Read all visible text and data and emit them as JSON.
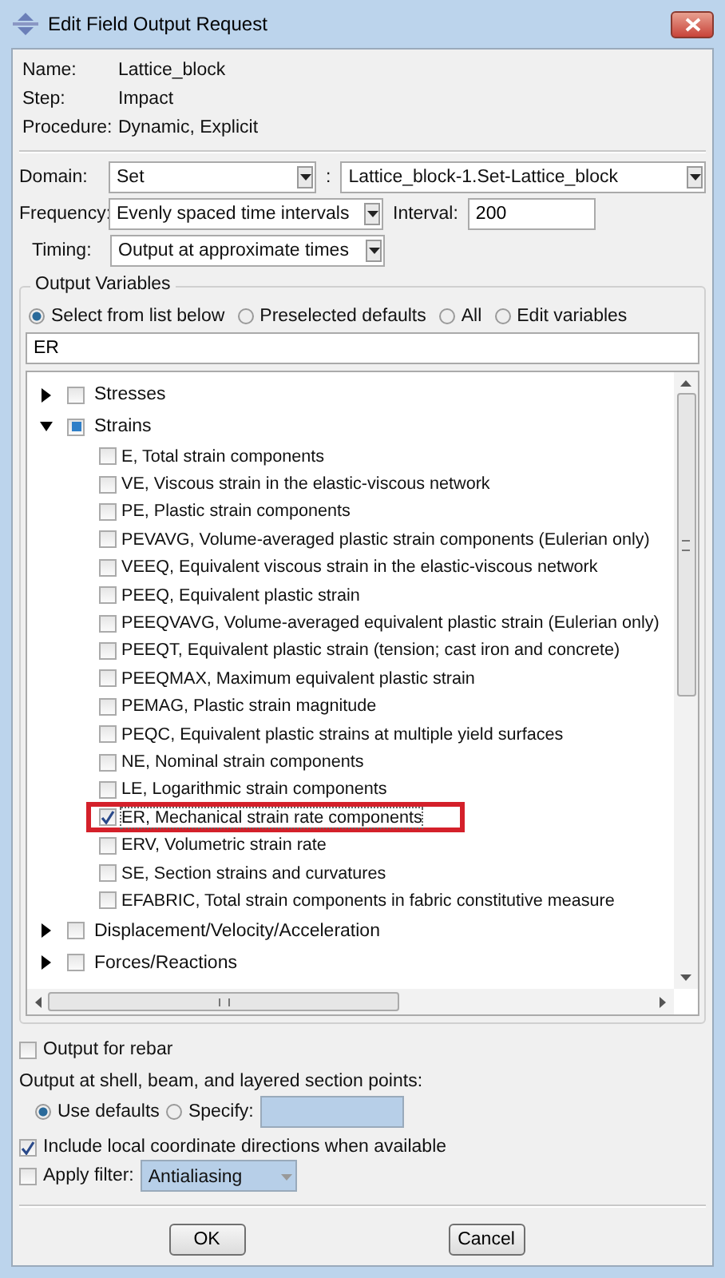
{
  "window": {
    "title": "Edit Field Output Request"
  },
  "info": [
    {
      "label": "Name:",
      "value": "Lattice_block"
    },
    {
      "label": "Step:",
      "value": "Impact"
    },
    {
      "label": "Procedure:",
      "value": "Dynamic, Explicit"
    }
  ],
  "domain": {
    "label": "Domain:",
    "value": "Set",
    "separator": ":",
    "target": "Lattice_block-1.Set-Lattice_block"
  },
  "frequency": {
    "label": "Frequency:",
    "value": "Evenly spaced time intervals",
    "interval_label": "Interval:",
    "interval": "200"
  },
  "timing": {
    "label": "Timing:",
    "value": "Output at approximate times"
  },
  "output_variables": {
    "title": "Output Variables",
    "modes": [
      {
        "label": "Select from list below",
        "selected": true
      },
      {
        "label": "Preselected defaults",
        "selected": false
      },
      {
        "label": "All",
        "selected": false
      },
      {
        "label": "Edit variables",
        "selected": false
      }
    ],
    "filter": "ER",
    "tree": [
      {
        "label": "Stresses",
        "expanded": false,
        "checked": false,
        "partial": false
      },
      {
        "label": "Strains",
        "expanded": true,
        "checked": false,
        "partial": true,
        "children": [
          {
            "label": "E, Total strain components",
            "checked": false,
            "highlighted": false
          },
          {
            "label": "VE, Viscous strain in the elastic-viscous network",
            "checked": false,
            "highlighted": false
          },
          {
            "label": "PE, Plastic strain components",
            "checked": false,
            "highlighted": false
          },
          {
            "label": "PEVAVG, Volume-averaged plastic strain components (Eulerian only)",
            "checked": false,
            "highlighted": false
          },
          {
            "label": "VEEQ, Equivalent viscous strain in the elastic-viscous network",
            "checked": false,
            "highlighted": false
          },
          {
            "label": "PEEQ, Equivalent plastic strain",
            "checked": false,
            "highlighted": false
          },
          {
            "label": "PEEQVAVG, Volume-averaged equivalent plastic strain (Eulerian only)",
            "checked": false,
            "highlighted": false
          },
          {
            "label": "PEEQT, Equivalent plastic strain (tension; cast iron and concrete)",
            "checked": false,
            "highlighted": false
          },
          {
            "label": "PEEQMAX, Maximum equivalent plastic strain",
            "checked": false,
            "highlighted": false
          },
          {
            "label": "PEMAG, Plastic strain magnitude",
            "checked": false,
            "highlighted": false
          },
          {
            "label": "PEQC, Equivalent plastic strains at multiple yield surfaces",
            "checked": false,
            "highlighted": false
          },
          {
            "label": "NE, Nominal strain components",
            "checked": false,
            "highlighted": false
          },
          {
            "label": "LE, Logarithmic strain components",
            "checked": false,
            "highlighted": false
          },
          {
            "label": "ER, Mechanical strain rate components",
            "checked": true,
            "highlighted": true
          },
          {
            "label": "ERV, Volumetric strain rate",
            "checked": false,
            "highlighted": false
          },
          {
            "label": "SE, Section strains and curvatures",
            "checked": false,
            "highlighted": false
          },
          {
            "label": "EFABRIC, Total strain components in fabric constitutive measure",
            "checked": false,
            "highlighted": false
          }
        ]
      },
      {
        "label": "Displacement/Velocity/Acceleration",
        "expanded": false,
        "checked": false,
        "partial": false
      },
      {
        "label": "Forces/Reactions",
        "expanded": false,
        "checked": false,
        "partial": false
      }
    ]
  },
  "rebar": {
    "label": "Output for rebar",
    "checked": false
  },
  "section_points": {
    "label": "Output at shell, beam, and layered section points:",
    "options": [
      {
        "label": "Use defaults",
        "selected": true
      },
      {
        "label": "Specify:",
        "selected": false
      }
    ]
  },
  "local_coords": {
    "label": "Include local coordinate directions when available",
    "checked": true
  },
  "apply_filter": {
    "label": "Apply filter:",
    "checked": false,
    "value": "Antialiasing"
  },
  "buttons": [
    "OK",
    "Cancel"
  ]
}
